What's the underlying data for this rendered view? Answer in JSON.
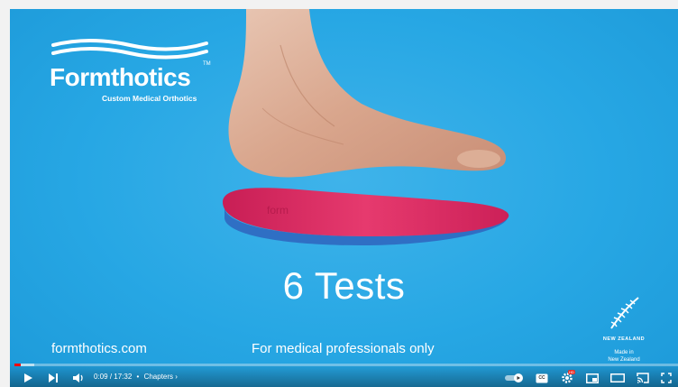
{
  "video": {
    "brand": "Formthotics",
    "brand_tm": "TM",
    "tagline": "Custom Medical Orthotics",
    "insole_text": "form",
    "headline": "6 Tests",
    "website": "formthotics.com",
    "notice": "For medical professionals only",
    "nz_badge": "NEW ZEALAND",
    "nz_made_line1": "Made in",
    "nz_made_line2": "New Zealand"
  },
  "player": {
    "current_time": "0:09",
    "duration": "17:32",
    "chapters_label": "Chapters",
    "progress_fraction": 0.009,
    "buffer_fraction": 0.03,
    "icons": [
      "play-icon",
      "next-icon",
      "volume-icon",
      "autoplay-toggle",
      "captions-icon",
      "settings-icon",
      "miniplayer-icon",
      "theater-icon",
      "cast-icon",
      "fullscreen-icon"
    ],
    "captions_label": "CC",
    "settings_badge": "HD"
  },
  "colors": {
    "background": "#27a7e4",
    "progress": "#ff0000",
    "insole_top": "#e0245e",
    "insole_bottom": "#2f6fc4"
  }
}
